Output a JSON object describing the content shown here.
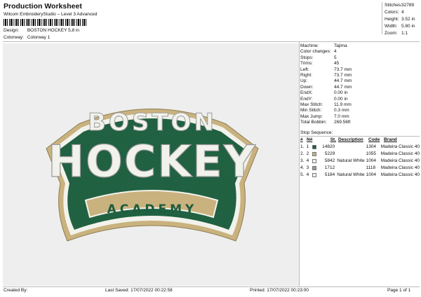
{
  "header": {
    "title": "Production Worksheet",
    "software": "Wilcom EmbroideryStudio – Level 3 Advanced"
  },
  "meta": {
    "design_label": "Design:",
    "design_value": "BOSTON HOCKEY 5,8 in",
    "colorway_label": "Colorway:",
    "colorway_value": "Colorway 1"
  },
  "stats": [
    {
      "label": "Stitches:",
      "value": "32789"
    },
    {
      "label": "Colors:",
      "value": "4"
    },
    {
      "label": "Height:",
      "value": "3.52 in"
    },
    {
      "label": "Width:",
      "value": "5.80 in"
    },
    {
      "label": "Zoom:",
      "value": "1:1"
    }
  ],
  "machine_info": [
    {
      "label": "Machine:",
      "value": "Tajima"
    },
    {
      "label": "Color changes:",
      "value": "4"
    },
    {
      "label": "Stops:",
      "value": "5"
    },
    {
      "label": "Trims:",
      "value": "45"
    },
    {
      "label": "Left:",
      "value": "73.7 mm"
    },
    {
      "label": "Right:",
      "value": "73.7 mm"
    },
    {
      "label": "Up:",
      "value": "44.7 mm"
    },
    {
      "label": "Down:",
      "value": "44.7 mm"
    },
    {
      "label": "EndX:",
      "value": "0.00 in"
    },
    {
      "label": "EndY:",
      "value": "0.00 in"
    },
    {
      "label": "Max Stitch:",
      "value": "11.9 mm"
    },
    {
      "label": "Min Stitch:",
      "value": "0.3 mm"
    },
    {
      "label": "Max Jump:",
      "value": "7.0 mm"
    },
    {
      "label": "Total Bobbin:",
      "value": "269.56ft"
    }
  ],
  "stop_sequence": {
    "label": "Stop Sequence:",
    "columns": [
      "#",
      "N#",
      "St.",
      "Description",
      "Code",
      "Brand"
    ],
    "rows": [
      {
        "num": "1.",
        "needle": "1",
        "color": "#1e5c3e",
        "stitches": "14820",
        "description": "",
        "code": "1304",
        "brand": "Madeira Classic 40"
      },
      {
        "num": "2.",
        "needle": "2",
        "color": "#c9b27e",
        "stitches": "5229",
        "description": "",
        "code": "1055",
        "brand": "Madeira Classic 40"
      },
      {
        "num": "3.",
        "needle": "4",
        "color": "#f2f2ec",
        "stitches": "5842",
        "description": "Natural White",
        "code": "1004",
        "brand": "Madeira Classic 40"
      },
      {
        "num": "4.",
        "needle": "3",
        "color": "#9a9a9a",
        "stitches": "1712",
        "description": "",
        "code": "1118",
        "brand": "Madeira Classic 40"
      },
      {
        "num": "5.",
        "needle": "4",
        "color": "#f2f2ec",
        "stitches": "5184",
        "description": "Natural White",
        "code": "1004",
        "brand": "Madeira Classic 40"
      }
    ]
  },
  "design": {
    "line1": "BOSTON",
    "line2": "HOCKEY",
    "line3": "ACADEMY",
    "colors": {
      "green": "#1e5c3e",
      "tan": "#c9b27e",
      "white": "#f2f2ec",
      "gray": "#9a9a9a",
      "background": "#eeeeee"
    }
  },
  "footer": {
    "created_by": "Created By:",
    "last_saved": "Last Saved: 17/07/2022 00:22:58",
    "printed": "Printed: 17/07/2022 00:23:00",
    "page": "Page 1 of 1"
  }
}
